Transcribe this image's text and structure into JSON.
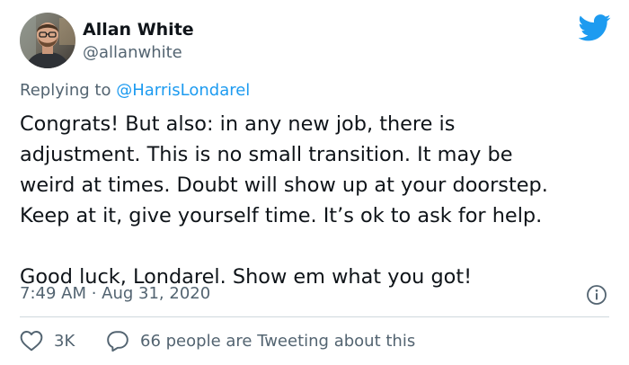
{
  "author": {
    "name": "Allan White",
    "handle": "@allanwhite"
  },
  "icons": {
    "avatar": "avatar-photo",
    "brand": "twitter-bird-icon",
    "info": "info-icon",
    "like": "heart-icon",
    "reply": "speech-bubble-icon"
  },
  "colors": {
    "brand": "#1d9bf0",
    "secondary_text": "#536471",
    "primary_text": "#0f1419",
    "divider": "#cfd9de"
  },
  "reply_context": {
    "prefix": "Replying to ",
    "mention": "@HarrisLondarel"
  },
  "tweet": {
    "text": "Congrats! But also: in any new job, there is\nadjustment. This is no small transition. It may be\nweird at times. Doubt will show up at your doorstep.\nKeep at it, give yourself time. It’s ok to ask for help.\n\nGood luck, Londarel. Show em what you got!",
    "timestamp": "7:49 AM · Aug 31, 2020"
  },
  "engagement": {
    "likes": "3K",
    "reply_summary": "66 people are Tweeting about this"
  }
}
